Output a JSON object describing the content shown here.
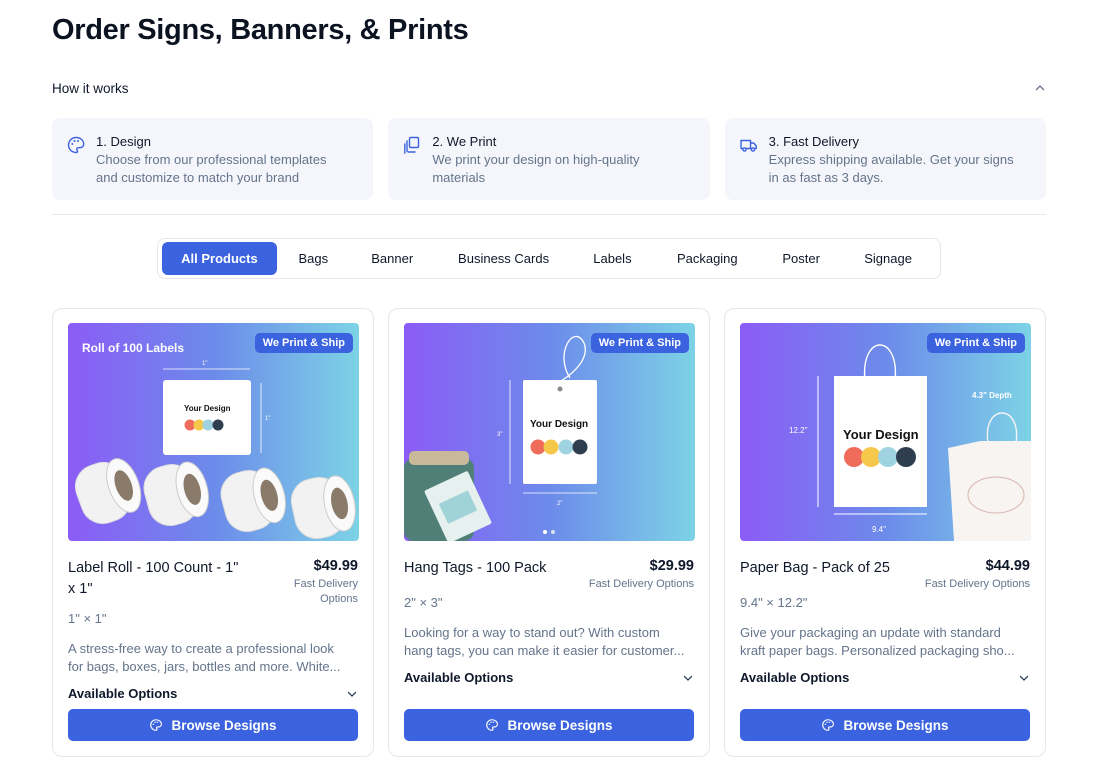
{
  "page": {
    "title": "Order Signs, Banners, & Prints"
  },
  "how_it_works": {
    "label": "How it works",
    "steps": [
      {
        "icon": "palette-icon",
        "title": "1. Design",
        "desc": [
          "Choose from our professional templates",
          "and customize to match your brand"
        ]
      },
      {
        "icon": "copy-print-icon",
        "title": "2. We Print",
        "desc": [
          "We print your design on high-quality",
          "materials"
        ]
      },
      {
        "icon": "truck-icon",
        "title": "3. Fast Delivery",
        "desc": [
          "Express shipping available. Get your signs",
          "in as fast as 3 days."
        ]
      }
    ]
  },
  "tabs": [
    "All Products",
    "Bags",
    "Banner",
    "Business Cards",
    "Labels",
    "Packaging",
    "Poster",
    "Signage"
  ],
  "active_tab": "All Products",
  "products": [
    {
      "badge": "We Print & Ship",
      "image_text": {
        "headline": "Roll of 100 Labels",
        "design": "Your Design",
        "dim_w": "1\"",
        "dim_h": "1\""
      },
      "name": [
        "Label Roll - 100 Count - 1\"",
        "x 1\""
      ],
      "price": "$49.99",
      "delivery": "Fast Delivery Options",
      "size": "1\" × 1\"",
      "desc": [
        "A stress-free way to create a professional look",
        "for bags, boxes, jars, bottles and more. White..."
      ],
      "options_label": "Available Options",
      "button": "Browse Designs"
    },
    {
      "badge": "We Print & Ship",
      "image_text": {
        "design": "Your Design",
        "dim_w": "2\"",
        "dim_h": "3\""
      },
      "name": [
        "Hang Tags - 100 Pack"
      ],
      "price": "$29.99",
      "delivery": "Fast Delivery Options",
      "size": "2\" × 3\"",
      "desc": [
        "Looking for a way to stand out? With custom",
        "hang tags, you can make it easier for customer..."
      ],
      "options_label": "Available Options",
      "button": "Browse Designs"
    },
    {
      "badge": "We Print & Ship",
      "image_text": {
        "design": "Your Design",
        "dim_w": "9.4\"",
        "dim_h": "12.2\"",
        "depth": "4.3\" Depth"
      },
      "name": [
        "Paper Bag - Pack of 25"
      ],
      "price": "$44.99",
      "delivery": "Fast Delivery Options",
      "size": "9.4\" × 12.2\"",
      "desc": [
        "Give your packaging an update with standard",
        "kraft paper bags. Personalized packaging sho..."
      ],
      "options_label": "Available Options",
      "button": "Browse Designs"
    }
  ],
  "colors": {
    "accent": "#3b63e0",
    "step_bg": "#f4f6fb",
    "muted": "#64748b",
    "dot_colors": [
      "#ef6b5a",
      "#f5c84c",
      "#9fd3e0",
      "#2f3e4e"
    ]
  }
}
